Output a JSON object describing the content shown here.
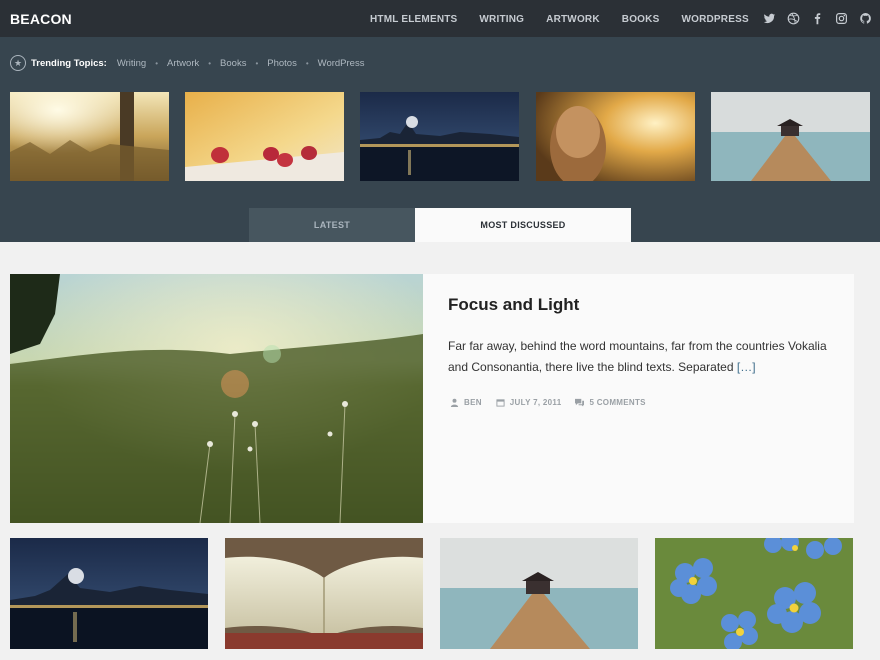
{
  "site": {
    "logo": "BEACON"
  },
  "nav": {
    "items": [
      "HTML ELEMENTS",
      "WRITING",
      "ARTWORK",
      "BOOKS",
      "WORDPRESS"
    ]
  },
  "social": {
    "icons": [
      "twitter-icon",
      "dribbble-icon",
      "facebook-icon",
      "instagram-icon",
      "github-icon"
    ]
  },
  "trending": {
    "label": "Trending Topics:",
    "topics": [
      "Writing",
      "Artwork",
      "Books",
      "Photos",
      "WordPress"
    ]
  },
  "thumbnails": [
    "field-sunset",
    "strawberries",
    "city-night",
    "girl-sunset",
    "pier"
  ],
  "tabs": {
    "latest": "LATEST",
    "most_discussed": "MOST DISCUSSED",
    "active": "most_discussed"
  },
  "featured": {
    "title": "Focus and Light",
    "excerpt": "Far far away, behind the word mountains, far from the countries Vokalia and Consonantia, there live the blind texts. Separated",
    "more": "[…]",
    "author": "BEN",
    "date": "JULY 7, 2011",
    "comments": "5 COMMENTS"
  },
  "grid": [
    "city-night",
    "open-book",
    "pier",
    "blue-flowers"
  ],
  "colors": {
    "topbar": "#2b3036",
    "header": "#37454f",
    "tab_inactive": "#47565f",
    "page_bg": "#f1f1f1",
    "link": "#3f6e8c"
  }
}
